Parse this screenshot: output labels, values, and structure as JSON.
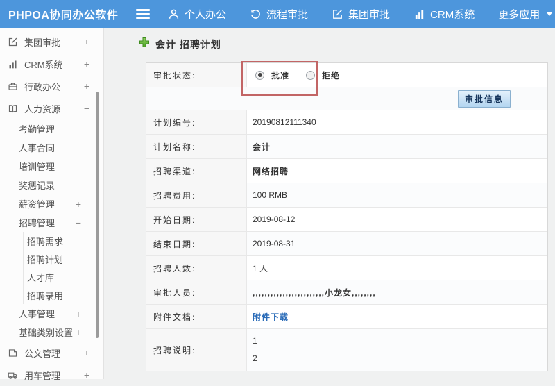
{
  "header": {
    "logo": "PHPOA协同办公软件",
    "nav": [
      {
        "label": "个人办公",
        "icon": "user-icon"
      },
      {
        "label": "流程审批",
        "icon": "history-icon"
      },
      {
        "label": "集团审批",
        "icon": "edit-square-icon"
      },
      {
        "label": "CRM系统",
        "icon": "bar-chart-icon"
      },
      {
        "label": "更多应用",
        "icon": "caret-down-icon"
      }
    ]
  },
  "sidebar": {
    "items": [
      {
        "label": "集团审批",
        "level": 1,
        "icon": "edit-square-icon",
        "toggle": "+"
      },
      {
        "label": "CRM系统",
        "level": 1,
        "icon": "bar-chart-icon",
        "toggle": "+"
      },
      {
        "label": "行政办公",
        "level": 1,
        "icon": "briefcase-icon",
        "toggle": "+"
      },
      {
        "label": "人力资源",
        "level": 1,
        "icon": "book-icon",
        "toggle": "−"
      },
      {
        "label": "考勤管理",
        "level": 2,
        "toggle": ""
      },
      {
        "label": "人事合同",
        "level": 2,
        "toggle": ""
      },
      {
        "label": "培训管理",
        "level": 2,
        "toggle": ""
      },
      {
        "label": "奖惩记录",
        "level": 2,
        "toggle": ""
      },
      {
        "label": "薪资管理",
        "level": 2,
        "toggle": "+"
      },
      {
        "label": "招聘管理",
        "level": 2,
        "toggle": "−"
      },
      {
        "label": "招聘需求",
        "level": 3,
        "toggle": ""
      },
      {
        "label": "招聘计划",
        "level": 3,
        "toggle": ""
      },
      {
        "label": "人才库",
        "level": 3,
        "toggle": ""
      },
      {
        "label": "招聘录用",
        "level": 3,
        "toggle": ""
      },
      {
        "label": "人事管理",
        "level": 2,
        "toggle": "+"
      },
      {
        "label": "基础类别设置",
        "level": 2,
        "toggle": "+"
      },
      {
        "label": "公文管理",
        "level": 1,
        "icon": "document-icon",
        "toggle": "+"
      },
      {
        "label": "用车管理",
        "level": 1,
        "icon": "truck-icon",
        "toggle": "+"
      }
    ]
  },
  "main": {
    "page_title": "会计 招聘计划",
    "title_icon": "green-plus-icon",
    "approval": {
      "status_label": "审批状态:",
      "approve_label": "批准",
      "approve_checked": true,
      "reject_label": "拒绝",
      "reject_checked": false,
      "info_button": "审批信息"
    },
    "fields": [
      {
        "label": "计划编号:",
        "value": "20190812111340"
      },
      {
        "label": "计划名称:",
        "value": "会计"
      },
      {
        "label": "招聘渠道:",
        "value": "网络招聘"
      },
      {
        "label": "招聘费用:",
        "value": "100 RMB"
      },
      {
        "label": "开始日期:",
        "value": "2019-08-12"
      },
      {
        "label": "结束日期:",
        "value": "2019-08-31"
      },
      {
        "label": "招聘人数:",
        "value": "1 人"
      },
      {
        "label": "审批人员:",
        "value": ",,,,,,,,,,,,,,,,,,,,,,,,小龙女,,,,,,,,"
      },
      {
        "label": "附件文档:",
        "value": "附件下载",
        "type": "link"
      },
      {
        "label": "招聘说明:",
        "value_lines": [
          "1",
          "2"
        ]
      }
    ]
  },
  "colors": {
    "header_blue": "#4d96dc",
    "annotation_red": "#c26565",
    "link_blue": "#2b6cb8",
    "plus_green": "#5cb632",
    "label_cell_bg": "#f7f7f7",
    "content_bg": "#f0f1f1"
  }
}
